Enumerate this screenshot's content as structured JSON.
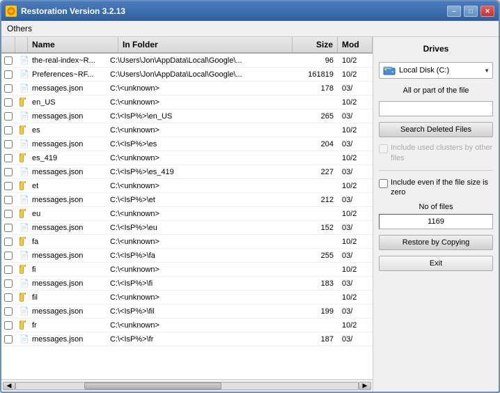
{
  "window": {
    "title": "Restoration Version 3.2.13",
    "menu": "Others"
  },
  "table": {
    "headers": [
      "Name",
      "In Folder",
      "Size",
      "Mod"
    ],
    "rows": [
      {
        "check": false,
        "type": "file",
        "name": "the-real-index~R...",
        "folder": "C:\\Users\\Jon\\AppData\\Local\\Google\\...",
        "size": "96",
        "mod": "10/2"
      },
      {
        "check": false,
        "type": "file",
        "name": "Preferences~RF...",
        "folder": "C:\\Users\\Jon\\AppData\\Local\\Google\\...",
        "size": "161819",
        "mod": "10/2"
      },
      {
        "check": false,
        "type": "file",
        "name": "messages.json",
        "folder": "C:\\<unknown>",
        "size": "178",
        "mod": "03/"
      },
      {
        "check": false,
        "type": "folder",
        "name": "en_US",
        "folder": "C:\\<unknown>",
        "size": "",
        "mod": "10/2"
      },
      {
        "check": false,
        "type": "file",
        "name": "messages.json",
        "folder": "C:\\<IsP%>\\en_US",
        "size": "265",
        "mod": "03/"
      },
      {
        "check": false,
        "type": "folder",
        "name": "es",
        "folder": "C:\\<unknown>",
        "size": "",
        "mod": "10/2"
      },
      {
        "check": false,
        "type": "file",
        "name": "messages.json",
        "folder": "C:\\<IsP%>\\es",
        "size": "204",
        "mod": "03/"
      },
      {
        "check": false,
        "type": "folder",
        "name": "es_419",
        "folder": "C:\\<unknown>",
        "size": "",
        "mod": "10/2"
      },
      {
        "check": false,
        "type": "file",
        "name": "messages.json",
        "folder": "C:\\<IsP%>\\es_419",
        "size": "227",
        "mod": "03/"
      },
      {
        "check": false,
        "type": "folder",
        "name": "et",
        "folder": "C:\\<unknown>",
        "size": "",
        "mod": "10/2"
      },
      {
        "check": false,
        "type": "file",
        "name": "messages.json",
        "folder": "C:\\<IsP%>\\et",
        "size": "212",
        "mod": "03/"
      },
      {
        "check": false,
        "type": "folder",
        "name": "eu",
        "folder": "C:\\<unknown>",
        "size": "",
        "mod": "10/2"
      },
      {
        "check": false,
        "type": "file",
        "name": "messages.json",
        "folder": "C:\\<IsP%>\\eu",
        "size": "152",
        "mod": "03/"
      },
      {
        "check": false,
        "type": "folder",
        "name": "fa",
        "folder": "C:\\<unknown>",
        "size": "",
        "mod": "10/2"
      },
      {
        "check": false,
        "type": "file",
        "name": "messages.json",
        "folder": "C:\\<IsP%>\\fa",
        "size": "255",
        "mod": "03/"
      },
      {
        "check": false,
        "type": "folder",
        "name": "fi",
        "folder": "C:\\<unknown>",
        "size": "",
        "mod": "10/2"
      },
      {
        "check": false,
        "type": "file",
        "name": "messages.json",
        "folder": "C:\\<IsP%>\\fi",
        "size": "183",
        "mod": "03/"
      },
      {
        "check": false,
        "type": "folder",
        "name": "fil",
        "folder": "C:\\<unknown>",
        "size": "",
        "mod": "10/2"
      },
      {
        "check": false,
        "type": "file",
        "name": "messages.json",
        "folder": "C:\\<IsP%>\\fil",
        "size": "199",
        "mod": "03/"
      },
      {
        "check": false,
        "type": "folder",
        "name": "fr",
        "folder": "C:\\<unknown>",
        "size": "",
        "mod": "10/2"
      },
      {
        "check": false,
        "type": "file",
        "name": "messages.json",
        "folder": "C:\\<IsP%>\\fr",
        "size": "187",
        "mod": "03/"
      }
    ]
  },
  "right_panel": {
    "drives_label": "Drives",
    "drive_name": "Local Disk (C:)",
    "file_filter_label": "All or part of the file",
    "file_filter_value": "",
    "search_btn": "Search Deleted Files",
    "include_used_label": "Include used clusters by other files",
    "include_zero_label": "Include even if the file size is zero",
    "no_of_files_label": "No of files",
    "no_of_files_value": "1169",
    "restore_btn": "Restore by Copying",
    "exit_btn": "Exit"
  }
}
